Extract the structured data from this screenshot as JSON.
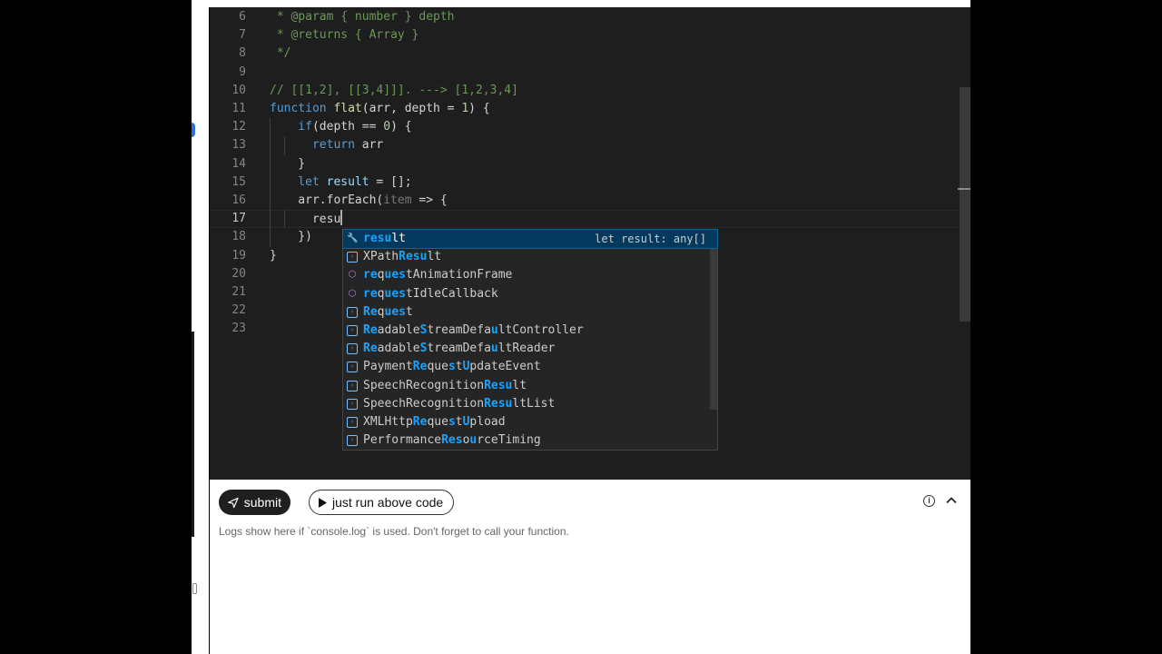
{
  "editor": {
    "lines": [
      {
        "n": "6",
        "tokens": [
          {
            "t": " * ",
            "c": "c-comment"
          },
          {
            "t": "@param",
            "c": "c-comment"
          },
          {
            "t": " { number } depth",
            "c": "c-comment"
          }
        ]
      },
      {
        "n": "7",
        "tokens": [
          {
            "t": " * ",
            "c": "c-comment"
          },
          {
            "t": "@returns",
            "c": "c-comment"
          },
          {
            "t": " { Array }",
            "c": "c-comment"
          }
        ]
      },
      {
        "n": "8",
        "tokens": [
          {
            "t": " */",
            "c": "c-comment"
          }
        ]
      },
      {
        "n": "9",
        "tokens": []
      },
      {
        "n": "10",
        "tokens": [
          {
            "t": "// [[1,2], [[3,4]]]. ---> [1,2,3,4]",
            "c": "c-comment"
          }
        ]
      },
      {
        "n": "11",
        "tokens": [
          {
            "t": "function ",
            "c": "c-kw"
          },
          {
            "t": "flat",
            "c": "c-fn"
          },
          {
            "t": "(arr, depth = ",
            "c": ""
          },
          {
            "t": "1",
            "c": "c-num"
          },
          {
            "t": ") {",
            "c": ""
          }
        ]
      },
      {
        "n": "12",
        "tokens": [
          {
            "t": "    if",
            "c": "c-kw"
          },
          {
            "t": "(depth == ",
            "c": ""
          },
          {
            "t": "0",
            "c": "c-num"
          },
          {
            "t": ") {",
            "c": ""
          }
        ]
      },
      {
        "n": "13",
        "tokens": [
          {
            "t": "      return ",
            "c": "c-kw"
          },
          {
            "t": "arr",
            "c": ""
          }
        ]
      },
      {
        "n": "14",
        "tokens": [
          {
            "t": "    }",
            "c": ""
          }
        ]
      },
      {
        "n": "15",
        "tokens": [
          {
            "t": "    let ",
            "c": "c-kw"
          },
          {
            "t": "result",
            "c": "c-var"
          },
          {
            "t": " = [];",
            "c": ""
          }
        ]
      },
      {
        "n": "16",
        "tokens": [
          {
            "t": "    arr.forEach(",
            "c": ""
          },
          {
            "t": "item",
            "c": "c-hint"
          },
          {
            "t": " => {",
            "c": ""
          }
        ]
      },
      {
        "n": "17",
        "tokens": [
          {
            "t": "      resu",
            "c": ""
          }
        ],
        "cursor": true,
        "active": true
      },
      {
        "n": "18",
        "tokens": [
          {
            "t": "    })",
            "c": ""
          }
        ]
      },
      {
        "n": "19",
        "tokens": [
          {
            "t": "}",
            "c": ""
          }
        ]
      },
      {
        "n": "20",
        "tokens": []
      },
      {
        "n": "21",
        "tokens": []
      },
      {
        "n": "22",
        "tokens": []
      },
      {
        "n": "23",
        "tokens": []
      }
    ]
  },
  "suggestions": {
    "detail": "let result: any[]",
    "items": [
      {
        "icon": "wrench-icon",
        "glyph": "🔧",
        "kind": "",
        "parts": [
          [
            "res",
            1
          ],
          [
            "u",
            1
          ],
          [
            "lt",
            0
          ]
        ]
      },
      {
        "icon": "variable-icon",
        "glyph": "[o]",
        "kind": "var",
        "parts": [
          [
            "XPath",
            0
          ],
          [
            "Resu",
            1
          ],
          [
            "lt",
            0
          ]
        ]
      },
      {
        "icon": "module-icon",
        "glyph": "⬡",
        "kind": "module",
        "parts": [
          [
            "re",
            1
          ],
          [
            "q",
            0
          ],
          [
            "u",
            1
          ],
          [
            "es",
            1
          ],
          [
            "tAnimationFrame",
            0
          ]
        ]
      },
      {
        "icon": "module-icon",
        "glyph": "⬡",
        "kind": "module",
        "parts": [
          [
            "re",
            1
          ],
          [
            "q",
            0
          ],
          [
            "u",
            1
          ],
          [
            "es",
            1
          ],
          [
            "tIdleCallback",
            0
          ]
        ]
      },
      {
        "icon": "variable-icon",
        "glyph": "[o]",
        "kind": "var",
        "parts": [
          [
            "Re",
            1
          ],
          [
            "q",
            0
          ],
          [
            "u",
            1
          ],
          [
            "es",
            1
          ],
          [
            "t",
            0
          ]
        ]
      },
      {
        "icon": "variable-icon",
        "glyph": "[o]",
        "kind": "var",
        "parts": [
          [
            "Re",
            1
          ],
          [
            "adable",
            0
          ],
          [
            "S",
            1
          ],
          [
            "treamDefa",
            0
          ],
          [
            "u",
            1
          ],
          [
            "ltController",
            0
          ]
        ]
      },
      {
        "icon": "variable-icon",
        "glyph": "[o]",
        "kind": "var",
        "parts": [
          [
            "Re",
            1
          ],
          [
            "adable",
            0
          ],
          [
            "S",
            1
          ],
          [
            "treamDefa",
            0
          ],
          [
            "u",
            1
          ],
          [
            "ltReader",
            0
          ]
        ]
      },
      {
        "icon": "variable-icon",
        "glyph": "[o]",
        "kind": "var",
        "parts": [
          [
            "Payment",
            0
          ],
          [
            "Re",
            1
          ],
          [
            "que",
            0
          ],
          [
            "s",
            1
          ],
          [
            "t",
            0
          ],
          [
            "U",
            1
          ],
          [
            "pdateEvent",
            0
          ]
        ]
      },
      {
        "icon": "variable-icon",
        "glyph": "[o]",
        "kind": "var",
        "parts": [
          [
            "SpeechRecognition",
            0
          ],
          [
            "Resu",
            1
          ],
          [
            "lt",
            0
          ]
        ]
      },
      {
        "icon": "variable-icon",
        "glyph": "[o]",
        "kind": "var",
        "parts": [
          [
            "SpeechRecognition",
            0
          ],
          [
            "Resu",
            1
          ],
          [
            "ltList",
            0
          ]
        ]
      },
      {
        "icon": "variable-icon",
        "glyph": "[o]",
        "kind": "var",
        "parts": [
          [
            "XMLHttp",
            0
          ],
          [
            "Re",
            1
          ],
          [
            "que",
            0
          ],
          [
            "s",
            1
          ],
          [
            "t",
            0
          ],
          [
            "U",
            1
          ],
          [
            "pload",
            0
          ]
        ]
      },
      {
        "icon": "variable-icon",
        "glyph": "[o]",
        "kind": "var",
        "parts": [
          [
            "Performance",
            0
          ],
          [
            "Res",
            1
          ],
          [
            "o",
            0
          ],
          [
            "u",
            1
          ],
          [
            "rceTiming",
            0
          ]
        ]
      }
    ]
  },
  "panel": {
    "submit_label": "submit",
    "run_label": "just run above code",
    "log_hint": "Logs show here if `console.log` is used. Don't forget to call your function."
  }
}
